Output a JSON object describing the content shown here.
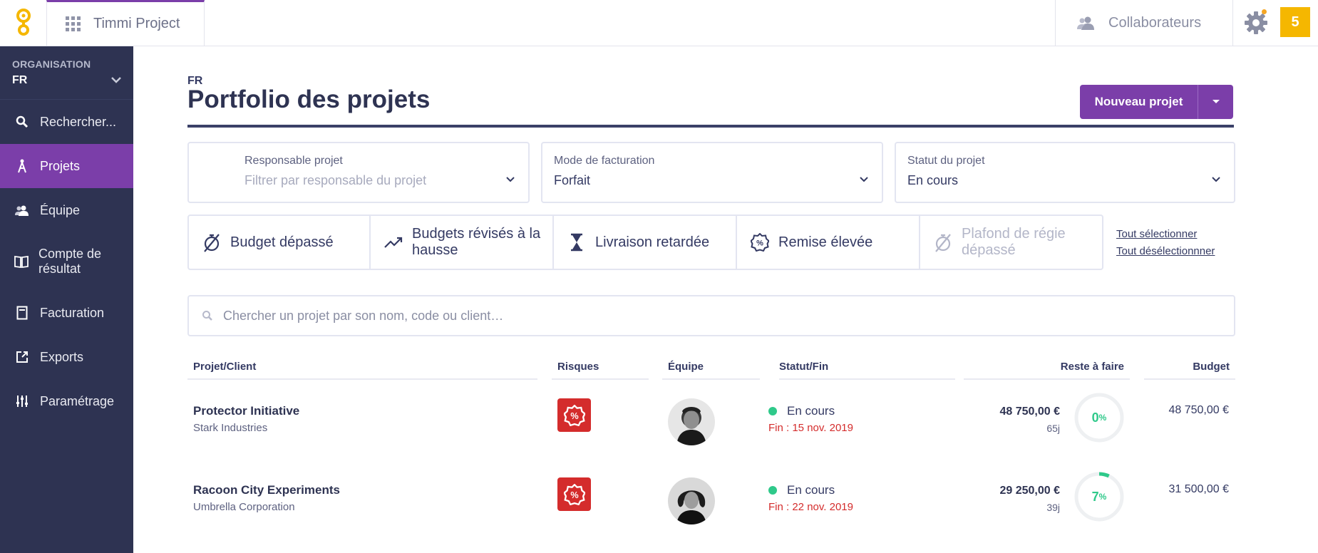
{
  "topbar": {
    "app_title": "Timmi Project",
    "collab_label": "Collaborateurs",
    "notification_count": "5"
  },
  "sidebar": {
    "org_label": "ORGANISATION",
    "org_value": "FR",
    "items": [
      {
        "label": "Rechercher...",
        "icon": "search-icon"
      },
      {
        "label": "Projets",
        "icon": "compass-icon",
        "active": true
      },
      {
        "label": "Équipe",
        "icon": "team-icon"
      },
      {
        "label": "Compte de résultat",
        "icon": "book-icon"
      },
      {
        "label": "Facturation",
        "icon": "invoice-icon"
      },
      {
        "label": "Exports",
        "icon": "export-icon"
      },
      {
        "label": "Paramétrage",
        "icon": "sliders-icon"
      }
    ]
  },
  "header": {
    "pre_title": "FR",
    "title": "Portfolio des projets",
    "new_button": "Nouveau projet"
  },
  "filters": {
    "responsable": {
      "label": "Responsable projet",
      "placeholder": "Filtrer par responsable du projet"
    },
    "facturation": {
      "label": "Mode de facturation",
      "value": "Forfait"
    },
    "statut": {
      "label": "Statut du projet",
      "value": "En cours"
    }
  },
  "risk_toggles": [
    {
      "label": "Budget dépassé",
      "icon": "budget-exceeded-icon"
    },
    {
      "label": "Budgets révisés à la hausse",
      "icon": "trend-up-icon"
    },
    {
      "label": "Livraison retardée",
      "icon": "hourglass-icon"
    },
    {
      "label": "Remise élevée",
      "icon": "discount-icon"
    },
    {
      "label": "Plafond de régie dépassé",
      "icon": "timer-off-icon",
      "disabled": true
    }
  ],
  "links": {
    "select_all": "Tout sélectionner",
    "deselect_all": "Tout désélectionnner"
  },
  "search": {
    "placeholder": "Chercher un projet par son nom, code ou client…"
  },
  "table": {
    "columns": [
      "Projet/Client",
      "Risques",
      "Équipe",
      "Statut/Fin",
      "Reste à faire",
      "Budget"
    ],
    "rows": [
      {
        "name": "Protector Initiative",
        "client": "Stark Industries",
        "status": "En cours",
        "end": "Fin : 15 nov. 2019",
        "reste": "48 750,00 €",
        "days": "65j",
        "progress": 0,
        "progress_label": "0",
        "budget": "48 750,00 €"
      },
      {
        "name": "Racoon City Experiments",
        "client": "Umbrella Corporation",
        "status": "En cours",
        "end": "Fin : 22 nov. 2019",
        "reste": "29 250,00 €",
        "days": "39j",
        "progress": 7,
        "progress_label": "7",
        "budget": "31 500,00 €"
      }
    ],
    "percent_sign": "%"
  },
  "colors": {
    "primary": "#7b3ea9",
    "sidebar": "#2e3352",
    "danger": "#d42c2c",
    "success": "#2fc98a",
    "badge": "#f5b700"
  }
}
